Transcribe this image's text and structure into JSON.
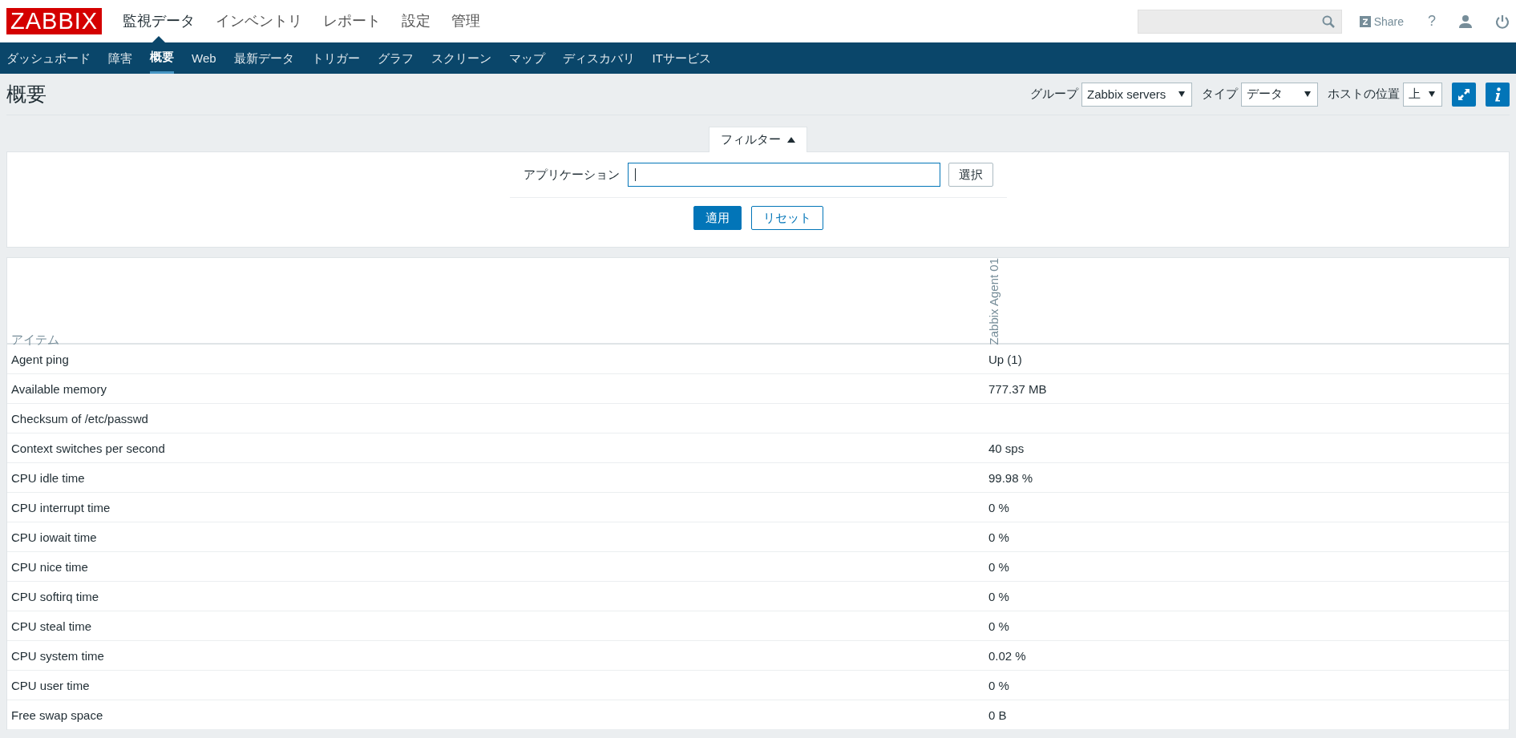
{
  "header": {
    "logo": "ZABBIX",
    "share": "Share",
    "help": "?"
  },
  "main_menu": [
    {
      "label": "監視データ",
      "selected": true
    },
    {
      "label": "インベントリ",
      "selected": false
    },
    {
      "label": "レポート",
      "selected": false
    },
    {
      "label": "設定",
      "selected": false
    },
    {
      "label": "管理",
      "selected": false
    }
  ],
  "sub_menu": [
    {
      "label": "ダッシュボード",
      "selected": false
    },
    {
      "label": "障害",
      "selected": false
    },
    {
      "label": "概要",
      "selected": true
    },
    {
      "label": "Web",
      "selected": false
    },
    {
      "label": "最新データ",
      "selected": false
    },
    {
      "label": "トリガー",
      "selected": false
    },
    {
      "label": "グラフ",
      "selected": false
    },
    {
      "label": "スクリーン",
      "selected": false
    },
    {
      "label": "マップ",
      "selected": false
    },
    {
      "label": "ディスカバリ",
      "selected": false
    },
    {
      "label": "ITサービス",
      "selected": false
    }
  ],
  "page": {
    "title": "概要",
    "controls": [
      {
        "label": "グループ",
        "value": "Zabbix servers"
      },
      {
        "label": "タイプ",
        "value": "データ"
      },
      {
        "label": "ホストの位置",
        "value": "上"
      }
    ]
  },
  "filter": {
    "tab": "フィルター",
    "expanded": true,
    "field_label": "アプリケーション",
    "select_button": "選択",
    "apply": "適用",
    "reset": "リセット"
  },
  "table": {
    "columns": [
      "アイテム",
      "Zabbix Agent 01"
    ],
    "rows": [
      {
        "item": "Agent ping",
        "value": "Up (1)"
      },
      {
        "item": "Available memory",
        "value": "777.37 MB"
      },
      {
        "item": "Checksum of /etc/passwd"
      },
      {
        "item": "Context switches per second",
        "value": "40 sps"
      },
      {
        "item": "CPU idle time",
        "value": "99.98 %"
      },
      {
        "item": "CPU interrupt time",
        "value": "0 %"
      },
      {
        "item": "CPU iowait time",
        "value": "0 %"
      },
      {
        "item": "CPU nice time",
        "value": "0 %"
      },
      {
        "item": "CPU softirq time",
        "value": "0 %"
      },
      {
        "item": "CPU steal time",
        "value": "0 %"
      },
      {
        "item": "CPU system time",
        "value": "0.02 %"
      },
      {
        "item": "CPU user time",
        "value": "0 %"
      },
      {
        "item": "Free swap space",
        "value": "0 B"
      }
    ]
  }
}
